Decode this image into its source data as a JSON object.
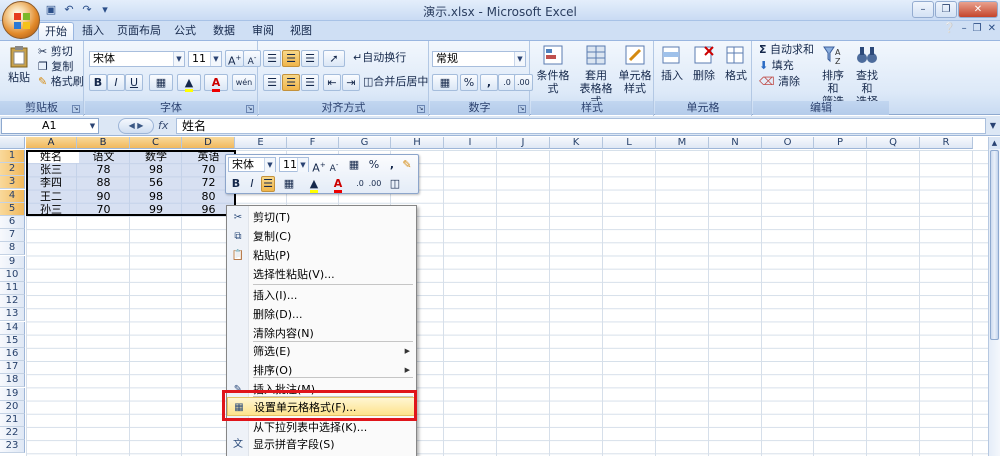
{
  "window": {
    "title": "演示.xlsx - Microsoft Excel"
  },
  "quick_access": [
    "save-icon",
    "undo-icon",
    "redo-icon"
  ],
  "tabs": [
    {
      "label": "开始",
      "active": true
    },
    {
      "label": "插入"
    },
    {
      "label": "页面布局"
    },
    {
      "label": "公式"
    },
    {
      "label": "数据"
    },
    {
      "label": "审阅"
    },
    {
      "label": "视图"
    }
  ],
  "ribbon": {
    "clipboard": {
      "label": "剪贴板",
      "paste": "粘贴",
      "cut": "剪切",
      "copy": "复制",
      "format_painter": "格式刷"
    },
    "font": {
      "label": "字体",
      "font_name": "宋体",
      "font_size": "11",
      "bold": "B",
      "italic": "I",
      "underline": "U",
      "font_color": "A",
      "change_case": "wén"
    },
    "alignment": {
      "label": "对齐方式",
      "wrap_text": "自动换行",
      "merge_center": "合并后居中"
    },
    "number": {
      "label": "数字",
      "format": "常规",
      "percent": "%",
      "comma": ","
    },
    "styles": {
      "label": "样式",
      "conditional": "条件格式",
      "table_format_l1": "套用",
      "table_format_l2": "表格格式",
      "cell_styles_l1": "单元格",
      "cell_styles_l2": "样式"
    },
    "cells": {
      "label": "单元格",
      "insert": "插入",
      "delete": "删除",
      "format": "格式"
    },
    "editing": {
      "label": "编辑",
      "autosum": "自动求和",
      "fill": "填充",
      "clear": "清除",
      "sort_filter_l1": "排序和",
      "sort_filter_l2": "筛选",
      "find_select_l1": "查找和",
      "find_select_l2": "选择"
    }
  },
  "formula_bar": {
    "name_box": "A1",
    "fx": "fx",
    "value": "姓名"
  },
  "sheet": {
    "columns": [
      "A",
      "B",
      "C",
      "D",
      "E",
      "F",
      "G",
      "H",
      "I",
      "J",
      "K",
      "L",
      "M",
      "N",
      "O",
      "P",
      "Q",
      "R"
    ],
    "rows": [
      "1",
      "2",
      "3",
      "4",
      "5",
      "6",
      "7",
      "8",
      "9",
      "10",
      "11",
      "12",
      "13",
      "14",
      "15",
      "16",
      "17",
      "18",
      "19",
      "20",
      "21",
      "22",
      "23"
    ],
    "data": [
      [
        "姓名",
        "语文",
        "数学",
        "英语"
      ],
      [
        "张三",
        "78",
        "98",
        "70"
      ],
      [
        "李四",
        "88",
        "56",
        "72"
      ],
      [
        "王二",
        "90",
        "98",
        "80"
      ],
      [
        "孙三",
        "70",
        "99",
        "96"
      ]
    ]
  },
  "mini_toolbar": {
    "font_name": "宋体",
    "font_size": "11",
    "percent": "%",
    "comma": ",",
    "bold": "B",
    "italic": "I",
    "font_color": "A"
  },
  "context_menu": {
    "items": [
      {
        "label": "剪切(T)",
        "icon": "scissors-icon"
      },
      {
        "label": "复制(C)",
        "icon": "copy-icon"
      },
      {
        "label": "粘贴(P)",
        "icon": "paste-icon"
      },
      {
        "label": "选择性粘贴(V)..."
      },
      {
        "label": "插入(I)..."
      },
      {
        "label": "删除(D)..."
      },
      {
        "label": "清除内容(N)"
      },
      {
        "label": "筛选(E)",
        "submenu": true
      },
      {
        "label": "排序(O)",
        "submenu": true
      },
      {
        "label": "插入批注(M)",
        "icon": "comment-icon"
      },
      {
        "label": "设置单元格格式(F)...",
        "icon": "format-cells-icon",
        "highlighted": true
      },
      {
        "label": "从下拉列表中选择(K)..."
      },
      {
        "label": "显示拼音字段(S)",
        "icon": "phonetic-icon"
      }
    ]
  },
  "colors": {
    "accent": "#f0b54a",
    "highlight_box": "#e0151b",
    "ribbon_bg": "#dde9f8"
  }
}
